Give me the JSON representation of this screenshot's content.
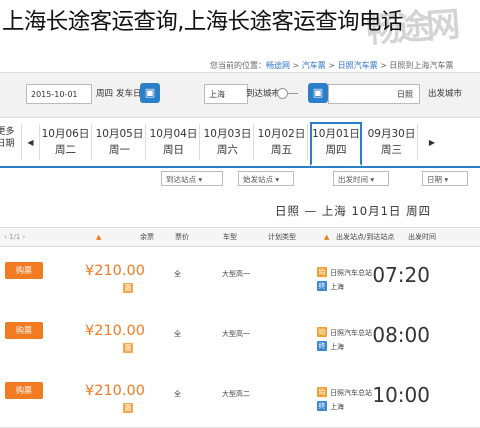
{
  "title": "上海长途客运查询,上海长途客运查询电话",
  "breadcrumb": {
    "prefix": "您当前的位置：",
    "items": [
      "畅途网",
      "汽车票",
      "日照汽车票",
      "日照到上海汽车票"
    ],
    "sep": " > "
  },
  "search": {
    "date_value": "2015-10-01",
    "weekday_value": "周四",
    "depart_date_label": "发车日期",
    "arrive_city_label": "到达城市",
    "arrive_city_value": "上海",
    "depart_city_label": "出发城市",
    "depart_city_value": "日照"
  },
  "date_tabs": {
    "more_label": "更多\n日期",
    "days": [
      {
        "date": "10月06日",
        "weekday": "周二"
      },
      {
        "date": "10月05日",
        "weekday": "周一"
      },
      {
        "date": "10月04日",
        "weekday": "周日"
      },
      {
        "date": "10月03日",
        "weekday": "周六"
      },
      {
        "date": "10月02日",
        "weekday": "周五"
      },
      {
        "date": "10月01日",
        "weekday": "周四"
      },
      {
        "date": "09月30日",
        "weekday": "周三"
      }
    ],
    "active_index": 5
  },
  "filters": {
    "arrive_station": "到达站点",
    "depart_station": "始发站点",
    "depart_time": "出发时间",
    "date": "日期"
  },
  "results_heading": "日照 — 上海   10月1日   周四",
  "table": {
    "pager": "1/1",
    "headers": [
      "出发时间",
      "出发站点/到达站点",
      "计划类型",
      "车型",
      "票价",
      "余票"
    ],
    "rows": [
      {
        "buy": "购票",
        "price": "¥210.00",
        "remaining": "全",
        "bus_type": "大型高一",
        "depart_station": "日照汽车总站",
        "arrive_station": "上海",
        "time": "07:20"
      },
      {
        "buy": "购票",
        "price": "¥210.00",
        "remaining": "全",
        "bus_type": "大型高一",
        "depart_station": "日照汽车总站",
        "arrive_station": "上海",
        "time": "08:00"
      },
      {
        "buy": "购票",
        "price": "¥210.00",
        "remaining": "全",
        "bus_type": "大型高二",
        "depart_station": "日照汽车总站",
        "arrive_station": "上海",
        "time": "10:00"
      }
    ]
  },
  "colors": {
    "accent": "#2b7ec8",
    "buy": "#f07b22",
    "price": "#f07b22"
  }
}
